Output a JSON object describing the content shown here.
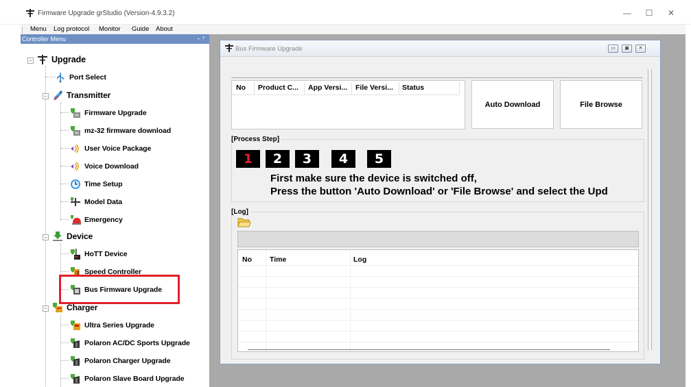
{
  "window": {
    "title": "Firmware Upgrade grStudio (Version-4.9.3.2)",
    "controls": {
      "minimize": "—",
      "maximize": "☐",
      "close": "✕"
    }
  },
  "menubar": {
    "items": [
      "Menu",
      "Log protocol",
      "Monitor",
      "Guide",
      "About"
    ]
  },
  "left_panel": {
    "header": "Controller Menu",
    "header_pin": "▾ ᛘ",
    "tree": {
      "upgrade": "Upgrade",
      "port_select": "Port Select",
      "transmitter": "Transmitter",
      "firmware_upgrade": "Firmware Upgrade",
      "mz32": "mz-32 firmware download",
      "user_voice": "User Voice Package",
      "voice_download": "Voice Download",
      "time_setup": "Time Setup",
      "model_data": "Model Data",
      "emergency": "Emergency",
      "device": "Device",
      "hott_device": "HoTT Device",
      "speed_controller": "Speed Controller",
      "bus_firmware": "Bus Firmware Upgrade",
      "charger": "Charger",
      "ultra_series": "Ultra Series Upgrade",
      "polaron_acdc": "Polaron AC/DC Sports Upgrade",
      "polaron_charger": "Polaron Charger Upgrade",
      "polaron_slave": "Polaron Slave Board Upgrade"
    }
  },
  "child_window": {
    "title": "Bus Firmware Upgrade",
    "controls": {
      "minimize": "▭",
      "maximize": "▣",
      "close": "✕"
    },
    "device_table": {
      "columns": [
        "No",
        "Product C...",
        "App Versi...",
        "File Versi...",
        "Status"
      ]
    },
    "auto_download": "Auto Download",
    "file_browse": "File Browse",
    "process_label": "[Process Step]",
    "steps": [
      "1",
      "2",
      "3",
      "4",
      "5"
    ],
    "active_step": 1,
    "message_line1": "First make sure the device is switched off,",
    "message_line2": "Press the button 'Auto Download' or 'File Browse' and select the Upd",
    "log_label": "[Log]",
    "log_table": {
      "columns": [
        "No",
        "Time",
        "Log"
      ]
    }
  },
  "colors": {
    "highlight_box": "#e0202a",
    "active_step_text": "#e0202a",
    "panel_header": "#6d8fc4",
    "mdi_background": "#a9a9a9"
  }
}
